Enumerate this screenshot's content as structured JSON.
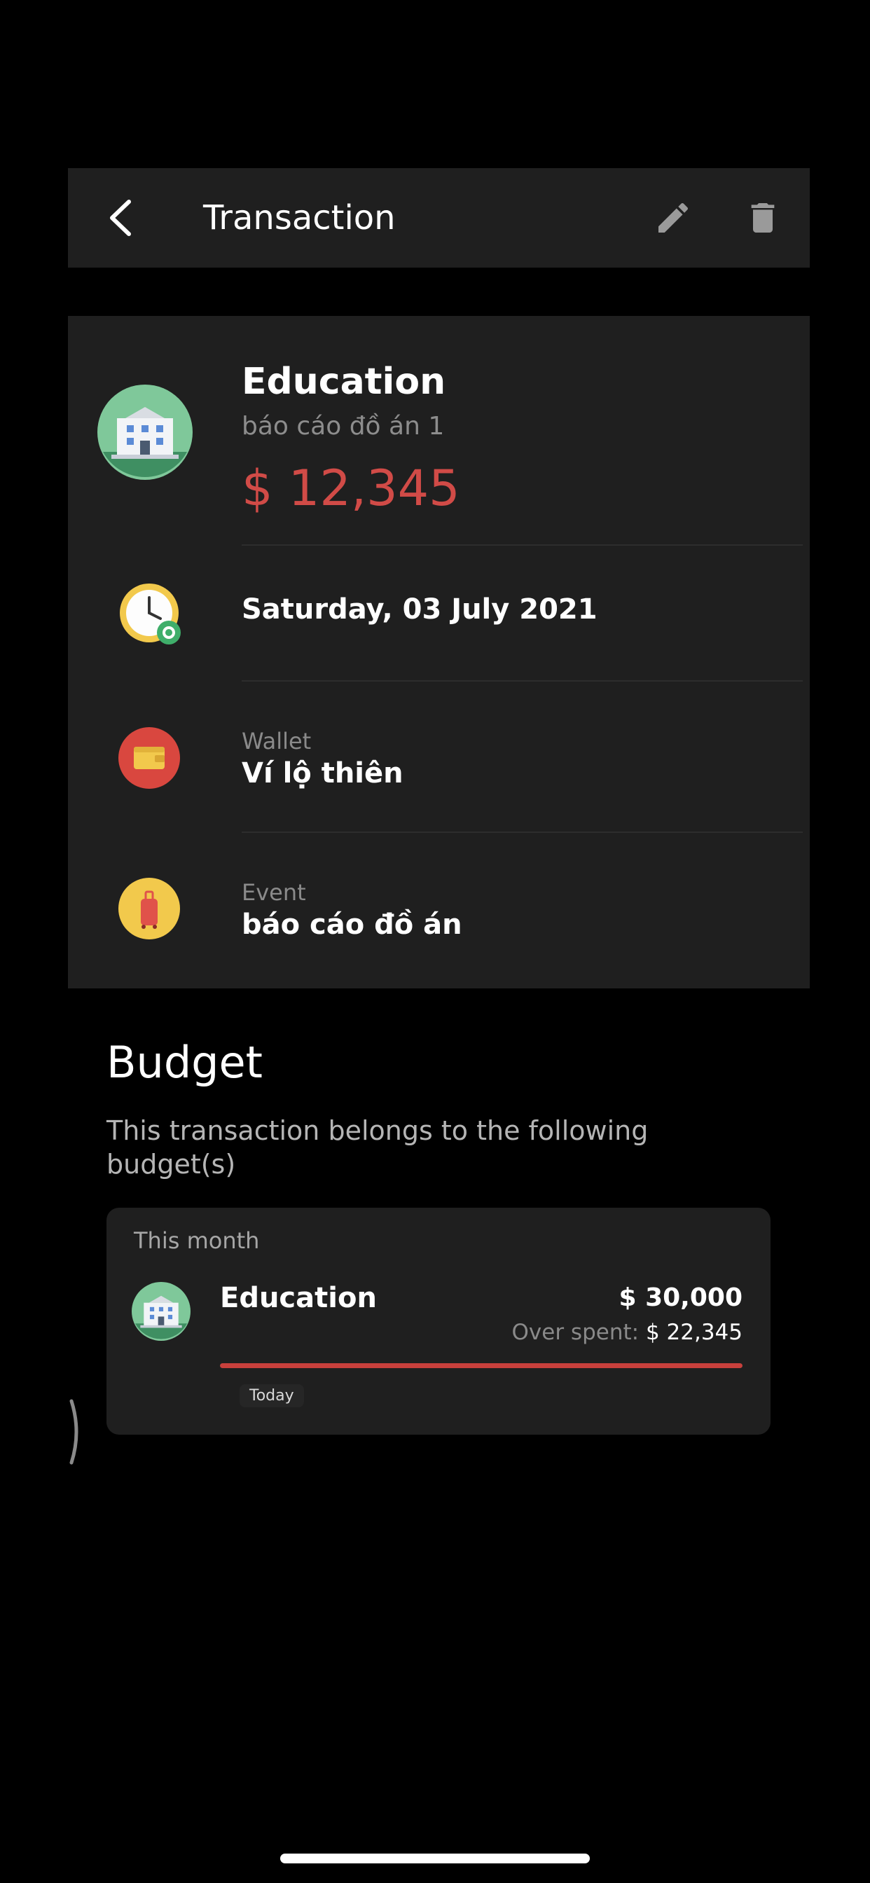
{
  "header": {
    "title": "Transaction",
    "back_icon": "chevron-left-icon",
    "edit_icon": "pencil-icon",
    "delete_icon": "trash-icon"
  },
  "transaction": {
    "category": "Education",
    "category_icon": "building-icon",
    "note": "báo cáo đồ án 1",
    "amount": "$ 12,345",
    "amount_color": "#d14b47",
    "date": "Saturday, 03 July 2021",
    "date_icon": "clock-icon",
    "wallet_label": "Wallet",
    "wallet_value": "Ví lộ thiên",
    "wallet_icon": "wallet-icon",
    "event_label": "Event",
    "event_value": "báo cáo đồ án",
    "event_icon": "luggage-icon"
  },
  "budget": {
    "heading": "Budget",
    "description": "This transaction belongs to the following budget(s)",
    "card": {
      "period": "This month",
      "name": "Education",
      "icon": "building-icon",
      "total": "$ 30,000",
      "overspent_label": "Over spent:",
      "overspent_value": "$ 22,345",
      "progress_fraction": 1.0,
      "progress_color": "#c8403c",
      "today_label": "Today"
    }
  },
  "colors": {
    "background": "#000000",
    "surface": "#1f1f1f",
    "accent_red": "#d14b47"
  }
}
